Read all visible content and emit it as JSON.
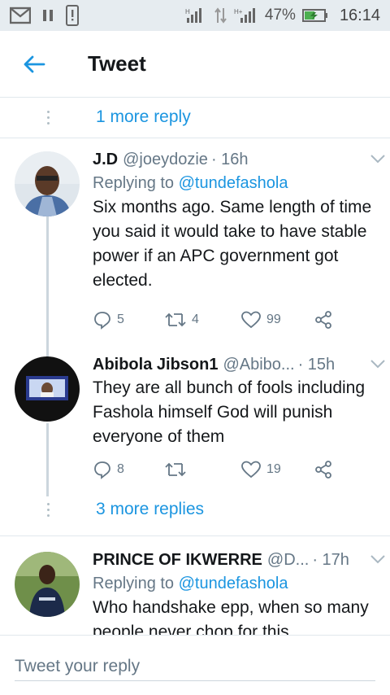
{
  "status_bar": {
    "battery": "47%",
    "time": "16:14"
  },
  "header": {
    "title": "Tweet"
  },
  "top_more_replies": "1 more reply",
  "tweets": [
    {
      "name": "J.D",
      "handle": "@joeydozie",
      "time": "· 16h",
      "replying_label": "Replying to",
      "replying_to": "@tundefashola",
      "text": "Six months ago. Same length of time you said it would take to have stable power if an APC government got elected.",
      "replies": "5",
      "retweets": "4",
      "likes": "99"
    },
    {
      "name": "Abibola Jibson1",
      "handle": "@Abibo...",
      "time": "· 15h",
      "text": "They are all bunch of fools including Fashola himself God will punish everyone of them",
      "replies": "8",
      "retweets": "",
      "likes": "19"
    },
    {
      "name": "PRINCE OF IKWERRE",
      "handle": "@D...",
      "time": "· 17h",
      "replying_label": "Replying to",
      "replying_to": "@tundefashola",
      "text": "Who handshake epp, when so many people never chop for this"
    }
  ],
  "thread_more_replies": "3 more replies",
  "reply_bar": {
    "placeholder": "Tweet your reply"
  },
  "colors": {
    "accent": "#1b95e0",
    "muted": "#657786",
    "status_bg": "#e6ecf0"
  }
}
